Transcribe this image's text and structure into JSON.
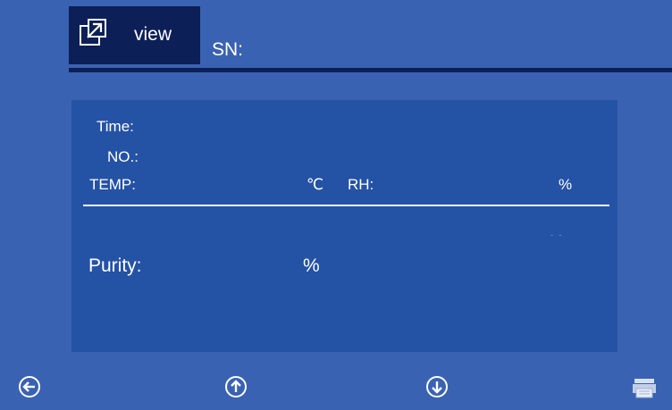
{
  "header": {
    "tab_label": "view",
    "tab_icon": "external-window-icon",
    "sn_label": "SN:",
    "sn_value": ""
  },
  "panel": {
    "time_label": "Time:",
    "no_label": "NO.:",
    "temp_label": "TEMP:",
    "temp_unit": "℃",
    "rh_label": "RH:",
    "rh_unit": "%",
    "dots": "- -",
    "purity_label": "Purity:",
    "purity_unit": "%"
  },
  "footer": {
    "back_icon": "back-arrow-icon",
    "up_icon": "up-arrow-icon",
    "down_icon": "down-arrow-icon",
    "print_icon": "printer-icon"
  },
  "colors": {
    "background": "#3a62b2",
    "panel": "#2452a5",
    "header_dark": "#0c1f57",
    "text": "#ffffff"
  }
}
